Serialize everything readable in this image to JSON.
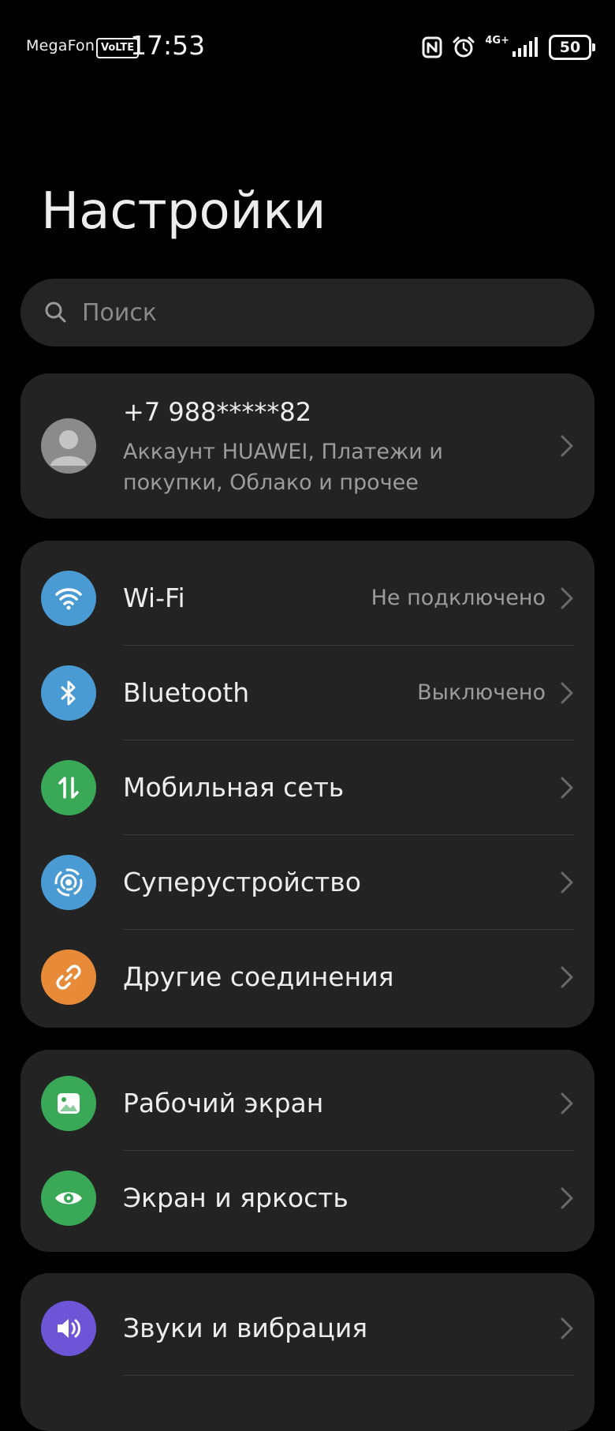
{
  "status_bar": {
    "carrier": "MegaFon",
    "volte": "VoLTE",
    "time": "17:53",
    "network": "4G+",
    "battery": "50"
  },
  "page": {
    "title": "Настройки"
  },
  "search": {
    "placeholder": "Поиск"
  },
  "account": {
    "phone": "+7 988*****82",
    "subtitle": "Аккаунт HUAWEI, Платежи и покупки, Облако и прочее"
  },
  "connections": [
    {
      "label": "Wi-Fi",
      "value": "Не подключено",
      "icon": "wifi-icon",
      "color": "#4a9ad4"
    },
    {
      "label": "Bluetooth",
      "value": "Выключено",
      "icon": "bluetooth-icon",
      "color": "#4a9ad4"
    },
    {
      "label": "Мобильная сеть",
      "value": "",
      "icon": "mobile-data-icon",
      "color": "#3aa957"
    },
    {
      "label": "Суперустройство",
      "value": "",
      "icon": "super-device-icon",
      "color": "#4a9ad4"
    },
    {
      "label": "Другие соединения",
      "value": "",
      "icon": "link-icon",
      "color": "#e78b39"
    }
  ],
  "display": [
    {
      "label": "Рабочий экран",
      "icon": "picture-icon",
      "color": "#3aa957"
    },
    {
      "label": "Экран и яркость",
      "icon": "eye-icon",
      "color": "#3aa957"
    }
  ],
  "sound": [
    {
      "label": "Звуки и вибрация",
      "icon": "speaker-icon",
      "color": "#6d55d8"
    }
  ]
}
